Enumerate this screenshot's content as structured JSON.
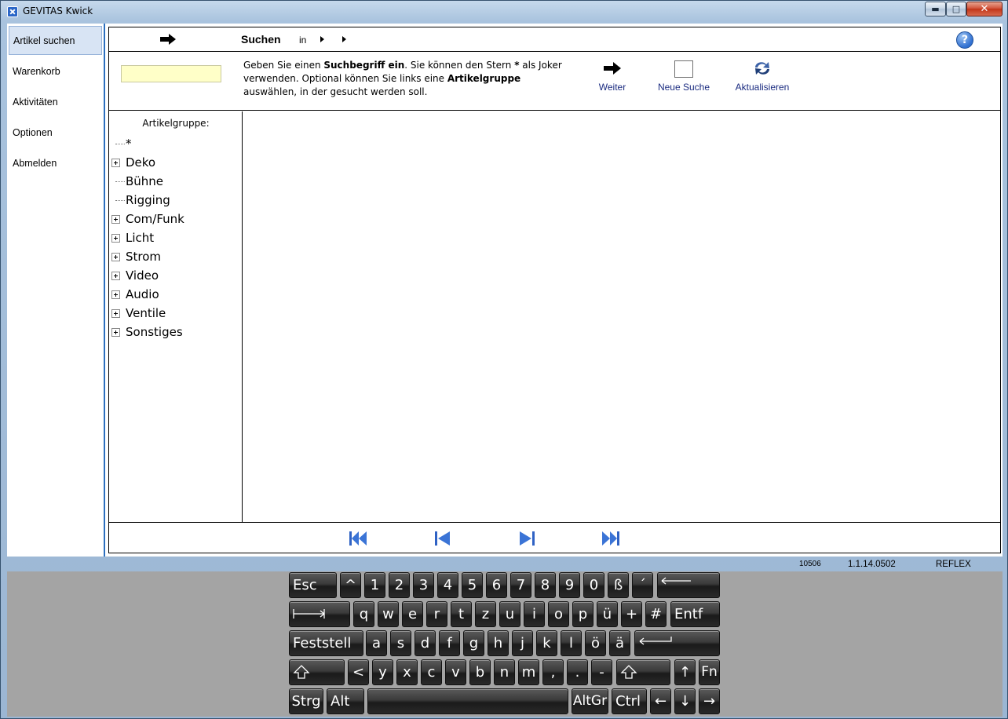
{
  "window": {
    "title": "GEVITAS Kwick",
    "buttons": {
      "minimize": "▬",
      "maximize": "□",
      "close": "✕"
    }
  },
  "nav": {
    "items": [
      {
        "label": "Artikel suchen",
        "active": true
      },
      {
        "label": "Warenkorb"
      },
      {
        "label": "Aktivitäten"
      },
      {
        "label": "Optionen"
      },
      {
        "label": "Abmelden"
      }
    ]
  },
  "header": {
    "title": "Suchen",
    "scope": "in",
    "help": "?"
  },
  "search": {
    "value": "",
    "instructions": {
      "p1": "Geben Sie einen ",
      "b1": "Suchbegriff ein",
      "p2": ". Sie können den Stern ",
      "b2": "*",
      "p3": " als Joker verwenden. Optional können Sie links eine ",
      "b3": "Artikelgruppe",
      "p4": " auswählen, in der gesucht werden soll."
    }
  },
  "toolbar": {
    "weiter": "Weiter",
    "neue_suche": "Neue Suche",
    "aktualisieren": "Aktualisieren"
  },
  "tree": {
    "caption": "Artikelgruppe:",
    "items": [
      {
        "label": "*",
        "expandable": false
      },
      {
        "label": "Deko",
        "expandable": true
      },
      {
        "label": "Bühne",
        "expandable": false
      },
      {
        "label": "Rigging",
        "expandable": false
      },
      {
        "label": "Com/Funk",
        "expandable": true
      },
      {
        "label": "Licht",
        "expandable": true
      },
      {
        "label": "Strom",
        "expandable": true
      },
      {
        "label": "Video",
        "expandable": true
      },
      {
        "label": "Audio",
        "expandable": true
      },
      {
        "label": "Ventile",
        "expandable": true
      },
      {
        "label": "Sonstiges",
        "expandable": true
      }
    ]
  },
  "status": {
    "code": "10506",
    "version": "1.1.14.0502",
    "user": "REFLEX"
  },
  "keyboard": {
    "row1": [
      "Esc",
      "^",
      "1",
      "2",
      "3",
      "4",
      "5",
      "6",
      "7",
      "8",
      "9",
      "0",
      "ß",
      "´"
    ],
    "row2": [
      "q",
      "w",
      "e",
      "r",
      "t",
      "z",
      "u",
      "i",
      "o",
      "p",
      "ü",
      "+",
      "#",
      "Entf"
    ],
    "row3": [
      "Feststell",
      "a",
      "s",
      "d",
      "f",
      "g",
      "h",
      "j",
      "k",
      "l",
      "ö",
      "ä"
    ],
    "row4": [
      "<",
      "y",
      "x",
      "c",
      "v",
      "b",
      "n",
      "m",
      ",",
      ".",
      "-",
      "↑",
      "Fn"
    ],
    "row5": [
      "Strg",
      "Alt",
      "AltGr",
      "Ctrl",
      "←",
      "↓",
      "→"
    ]
  }
}
